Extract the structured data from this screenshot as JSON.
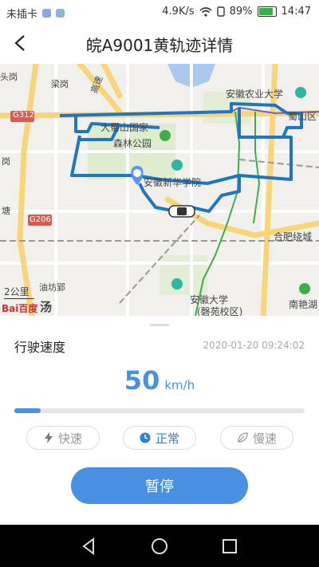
{
  "status_bar": {
    "carrier": "未插卡",
    "speed": "4.9K/s",
    "battery": "89%",
    "time": "14:47"
  },
  "header": {
    "title": "皖A9001黄轨迹详情"
  },
  "map": {
    "labels": {
      "l1": "头岗",
      "l2": "梁岗",
      "l3": "高速",
      "l4": "G312",
      "l5": "大蜀山国家",
      "l6": "森林公园",
      "l7": "安徽农业大学",
      "l8": "蜀山区",
      "l9": "安徽新华学院",
      "l10": "岗",
      "l11": "塘",
      "l12": "G206",
      "l13": "合肥绕城",
      "l14": "油坊郢",
      "l15": "安徽大学",
      "l16": "(磬苑校区)",
      "l17": "南艳湖",
      "l18": "汤"
    },
    "scale": "2公里",
    "logo": "Bai百度"
  },
  "panel": {
    "title": "行驶速度",
    "timestamp": "2020-01-20 09:24:02",
    "speed_value": "50",
    "speed_unit": "km/h",
    "progress": 0.09,
    "chips": [
      {
        "label": "快速",
        "icon": "lightning-icon"
      },
      {
        "label": "正常",
        "icon": "clock-icon"
      },
      {
        "label": "慢速",
        "icon": "leaf-icon"
      }
    ],
    "active_chip": 1,
    "pause_label": "暂停"
  },
  "colors": {
    "accent": "#4a90e2",
    "route": "#1f77c4"
  }
}
